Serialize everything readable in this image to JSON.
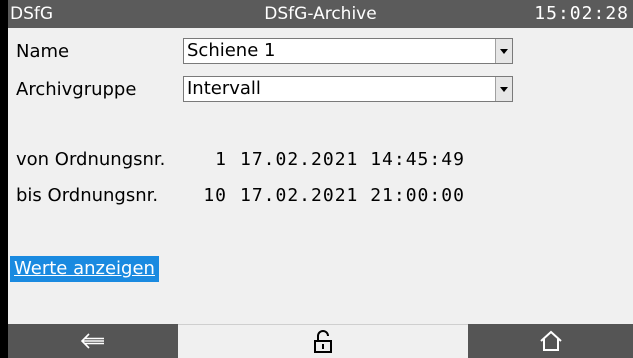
{
  "titlebar": {
    "left": "DSfG",
    "title": "DSfG-Archive",
    "time": "15:02:28"
  },
  "form": {
    "name_label": "Name",
    "name_value": "Schiene 1",
    "archivgruppe_label": "Archivgruppe",
    "archivgruppe_value": "Intervall"
  },
  "range": {
    "from": {
      "label": "von Ordnungsnr.",
      "number": "1",
      "datetime": "17.02.2021 14:45:49"
    },
    "to": {
      "label": "bis Ordnungsnr.",
      "number": "10",
      "datetime": "17.02.2021 21:00:00"
    }
  },
  "actions": {
    "show_values": "Werte anzeigen"
  },
  "footer": {
    "buttons": [
      {
        "icon": "back-arrow-icon"
      },
      {
        "icon": "unlock-icon"
      },
      {
        "icon": "home-icon"
      }
    ]
  },
  "colors": {
    "titlebar_bg": "#5b5b5b",
    "link_bg": "#1a8ae0",
    "screen_bg": "#f0f0f0"
  }
}
